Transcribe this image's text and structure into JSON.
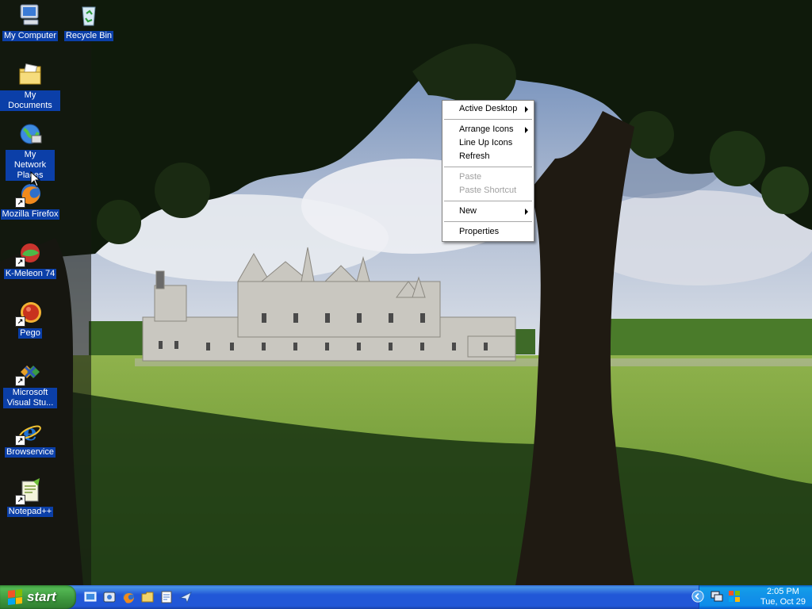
{
  "desktop": {
    "icons": [
      {
        "label": "My Computer"
      },
      {
        "label": "Recycle Bin"
      },
      {
        "label": "My Documents"
      },
      {
        "label": "My Network Places"
      },
      {
        "label": "Mozilla Firefox"
      },
      {
        "label": "K-Meleon 74"
      },
      {
        "label": "Pego"
      },
      {
        "label": "Microsoft Visual Stu..."
      },
      {
        "label": "Browservice"
      },
      {
        "label": "Notepad++"
      }
    ]
  },
  "context_menu": {
    "items": [
      {
        "label": "Active Desktop",
        "submenu": true,
        "enabled": true
      },
      {
        "label": "Arrange Icons",
        "submenu": true,
        "enabled": true
      },
      {
        "label": "Line Up Icons",
        "submenu": false,
        "enabled": true
      },
      {
        "label": "Refresh",
        "submenu": false,
        "enabled": true
      },
      {
        "label": "Paste",
        "submenu": false,
        "enabled": false
      },
      {
        "label": "Paste Shortcut",
        "submenu": false,
        "enabled": false
      },
      {
        "label": "New",
        "submenu": true,
        "enabled": true
      },
      {
        "label": "Properties",
        "submenu": false,
        "enabled": true
      }
    ]
  },
  "taskbar": {
    "start_label": "start",
    "quick_launch": [
      "show-desktop-icon",
      "media-icon",
      "firefox-icon",
      "folder-icon",
      "notepad-icon",
      "send-icon"
    ],
    "tray_icons": [
      "tray-expand-icon",
      "network-icon",
      "security-icon"
    ],
    "clock": {
      "time": "2:05 PM",
      "date": "Tue, Oct 29"
    }
  },
  "colors": {
    "taskbar_blue": "#2157d7",
    "start_green": "#3d963d",
    "tray_blue": "#1290e8",
    "label_highlight": "#0b3fa8"
  }
}
